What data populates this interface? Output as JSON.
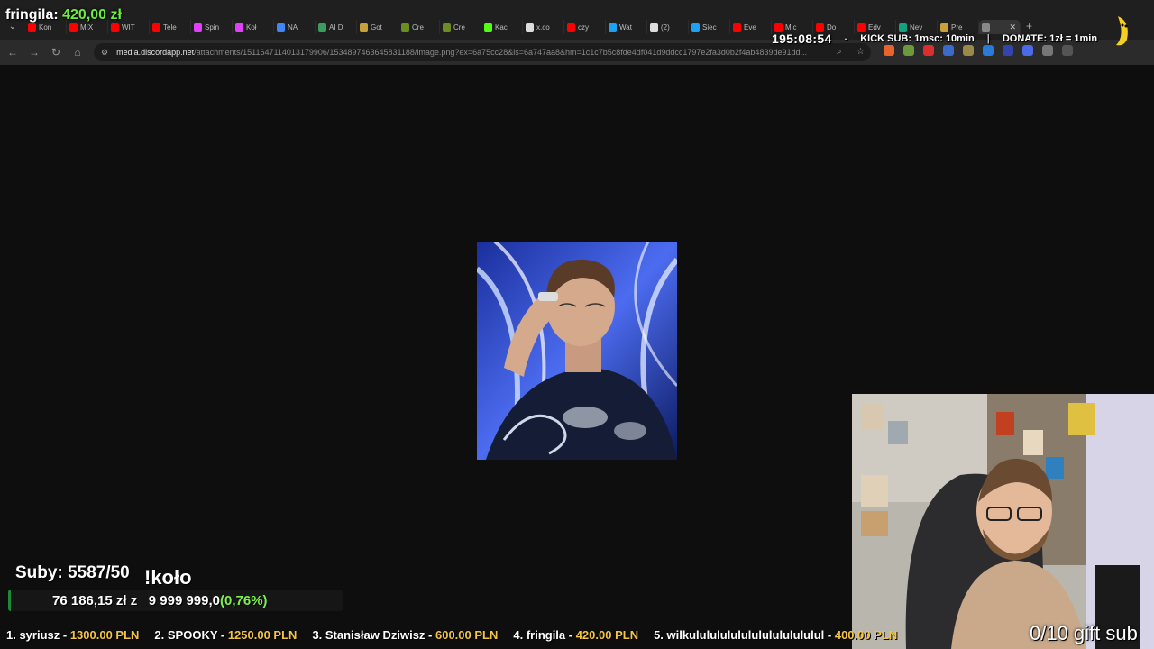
{
  "browser": {
    "tabs": [
      {
        "label": "Kon",
        "favicon_color": "#ff0000"
      },
      {
        "label": "MIX",
        "favicon_color": "#ff0000"
      },
      {
        "label": "WIT",
        "favicon_color": "#ff0000"
      },
      {
        "label": "Tele",
        "favicon_color": "#ff0000"
      },
      {
        "label": "Spin",
        "favicon_color": "#e040fb"
      },
      {
        "label": "Koł",
        "favicon_color": "#e040fb"
      },
      {
        "label": "NA",
        "favicon_color": "#4285f4"
      },
      {
        "label": "AI D",
        "favicon_color": "#3a9d5d"
      },
      {
        "label": "Got",
        "favicon_color": "#c8a13a"
      },
      {
        "label": "Cre",
        "favicon_color": "#6b8e23"
      },
      {
        "label": "Cre",
        "favicon_color": "#6b8e23"
      },
      {
        "label": "Kac",
        "favicon_color": "#53fc18"
      },
      {
        "label": "x.co",
        "favicon_color": "#dddddd"
      },
      {
        "label": "czy",
        "favicon_color": "#ff0000"
      },
      {
        "label": "Wat",
        "favicon_color": "#1da1f2"
      },
      {
        "label": "(2)",
        "favicon_color": "#dddddd"
      },
      {
        "label": "Siec",
        "favicon_color": "#1da1f2"
      },
      {
        "label": "Eve",
        "favicon_color": "#ff0000"
      },
      {
        "label": "Mic",
        "favicon_color": "#ff0000"
      },
      {
        "label": "Do",
        "favicon_color": "#ff0000"
      },
      {
        "label": "Edv",
        "favicon_color": "#ff0000"
      },
      {
        "label": "Nev",
        "favicon_color": "#10a37f"
      },
      {
        "label": "Pre",
        "favicon_color": "#c8a13a"
      }
    ],
    "url": {
      "domain": "media.discordapp.net",
      "path": "/attachments/1511647114013179906/1534897463645831188/image.png?ex=6a75cc28&is=6a747aa8&hm=1c1c7b5c8fde4df041d9ddcc1797e2fa3d0b2f4ab4839de91dd..."
    }
  },
  "overlay": {
    "top_donor": {
      "name": "fringila:",
      "amount": "420,00 zł"
    },
    "timer": "195:08:54",
    "separator_1": "-",
    "kick_sub": "KICK SUB: 1msc: 10min",
    "separator_2": "|",
    "donate_rate": "DONATE: 1zł = 1min",
    "sub_goal": "Suby: 5587/50",
    "wheel_command": "!koło",
    "donation_goal": {
      "current": "76 186,15 zł",
      "mid": "z",
      "target": "9 999 999,0",
      "percent": "(0,76%)",
      "progress_fraction": 0.0076
    },
    "leaderboard": [
      {
        "rank_name": "1. syriusz - ",
        "amount": "1300.00 PLN"
      },
      {
        "rank_name": "2. SPOOKY - ",
        "amount": "1250.00 PLN"
      },
      {
        "rank_name": "3. Stanisław Dziwisz - ",
        "amount": "600.00 PLN"
      },
      {
        "rank_name": "4. fringila - ",
        "amount": "420.00 PLN"
      },
      {
        "rank_name": "5. wilkululululululululululululul - ",
        "amount": "400.00 PLN"
      }
    ],
    "gift_sub": "0/10 gift sub"
  },
  "colors": {
    "accent_green": "#6cf03b",
    "amount_yellow": "#f5c542"
  }
}
